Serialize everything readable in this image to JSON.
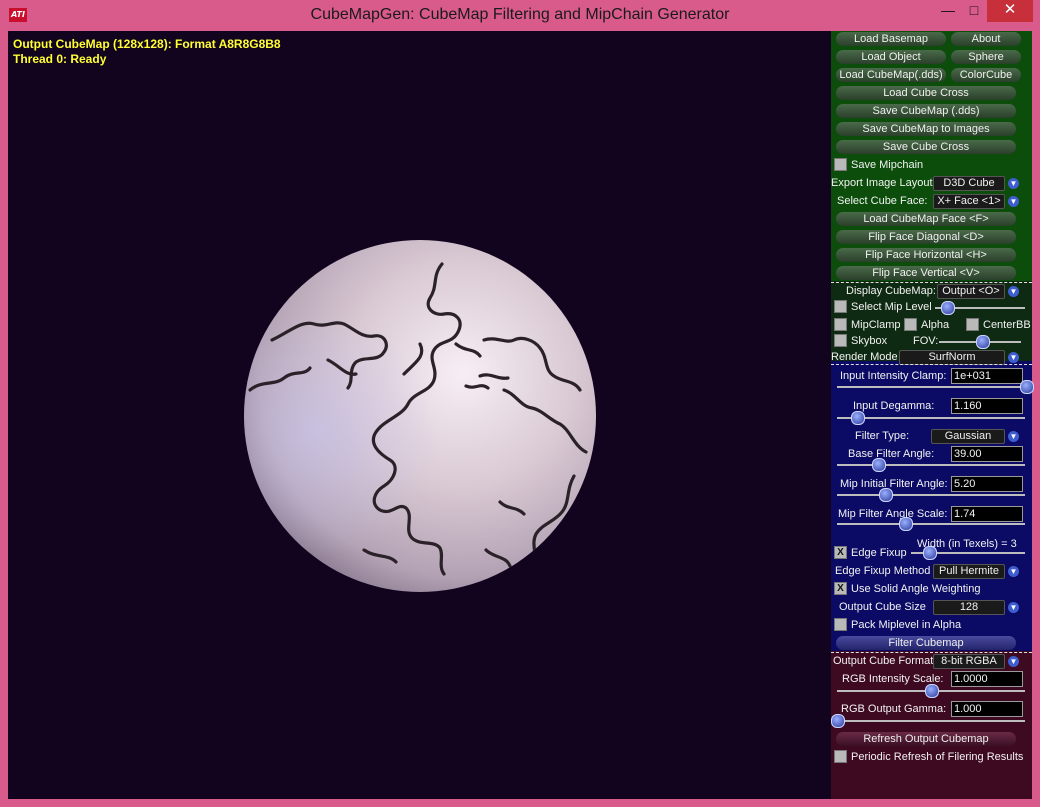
{
  "window": {
    "title": "CubeMapGen: CubeMap Filtering and MipChain Generator",
    "app_icon_text": "ATI",
    "minimize_glyph": "—",
    "maximize_glyph": "□",
    "close_glyph": "✕"
  },
  "viewport": {
    "status_line_1": "Output CubeMap (128x128): Format A8R8G8B8",
    "status_line_2": "Thread 0: Ready"
  },
  "panel": {
    "buttons": {
      "load_basemap": "Load Basemap",
      "about": "About",
      "load_object": "Load Object",
      "sphere": "Sphere",
      "load_cubemap_dds": "Load CubeMap(.dds)",
      "colorcube": "ColorCube",
      "load_cube_cross": "Load Cube Cross",
      "save_cubemap_dds": "Save CubeMap (.dds)",
      "save_cubemap_images": "Save CubeMap to Images",
      "save_cube_cross": "Save Cube Cross",
      "load_cubemap_face": "Load CubeMap Face   <F>",
      "flip_face_diagonal": "Flip Face Diagonal   <D>",
      "flip_face_horizontal": "Flip Face Horizontal   <H>",
      "flip_face_vertical": "Flip Face Vertical   <V>",
      "filter_cubemap": "Filter Cubemap",
      "refresh_output_cubemap": "Refresh Output Cubemap"
    },
    "labels": {
      "save_mipchain": "Save Mipchain",
      "export_image_layout": "Export Image Layout:",
      "select_cube_face": "Select Cube Face:",
      "display_cubemap": "Display CubeMap:",
      "select_mip_level": "Select Mip Level",
      "mipclamp": "MipClamp",
      "alpha": "Alpha",
      "centerbb": "CenterBB",
      "skybox": "Skybox",
      "fov": "FOV:",
      "render_mode": "Render Mode",
      "input_intensity_clamp": "Input Intensity Clamp:",
      "input_degamma": "Input Degamma:",
      "filter_type": "Filter Type:",
      "base_filter_angle": "Base Filter Angle:",
      "mip_initial_filter_angle": "Mip Initial Filter Angle:",
      "mip_filter_angle_scale": "Mip Filter Angle Scale:",
      "edge_fixup": "Edge Fixup",
      "edge_fixup_width": "Width (in Texels) = 3",
      "edge_fixup_method": "Edge Fixup Method",
      "use_solid_angle_weighting": "Use Solid Angle Weighting",
      "output_cube_size": "Output Cube Size",
      "pack_miplevel_in_alpha": "Pack Miplevel in Alpha",
      "output_cube_format": "Output Cube Format",
      "rgb_intensity_scale": "RGB Intensity Scale:",
      "rgb_output_gamma": "RGB Output Gamma:",
      "periodic_refresh": "Periodic Refresh of Filering Results"
    },
    "combos": {
      "export_image_layout": "D3D Cube",
      "select_cube_face": "X+ Face <1>",
      "display_cubemap": "Output <O>",
      "render_mode": "SurfNorm",
      "filter_type": "Gaussian",
      "edge_fixup_method": "Pull Hermite",
      "output_cube_size": "128",
      "output_cube_format": "8-bit RGBA"
    },
    "fields": {
      "input_intensity_clamp": "1e+031",
      "input_degamma": "1.160",
      "base_filter_angle": "39.00",
      "mip_initial_filter_angle": "5.20",
      "mip_filter_angle_scale": "1.74",
      "rgb_intensity_scale": "1.0000",
      "rgb_output_gamma": "1.000"
    },
    "checkboxes": {
      "save_mipchain": false,
      "select_mip_level": false,
      "mipclamp": false,
      "alpha": false,
      "centerbb": false,
      "skybox": false,
      "edge_fixup": true,
      "use_solid_angle_weighting": true,
      "pack_miplevel_in_alpha": false,
      "periodic_refresh": false
    },
    "check_glyph": "X",
    "dropdown_glyph": "▼"
  },
  "colors": {
    "window_frame": "#d95b8c",
    "viewport_bg": "#12041f",
    "status_text": "#ffff32",
    "panel_green": "#0c4d0c",
    "panel_blue": "#0b0b66",
    "panel_maroon": "#3e0a22"
  }
}
